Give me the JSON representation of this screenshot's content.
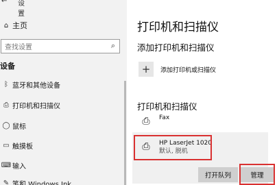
{
  "nav": {
    "back_icon": "back-arrow-icon",
    "title": "设置",
    "home_label": "主页",
    "search_placeholder": "查找设置",
    "section_label": "设备",
    "items": [
      {
        "icon": "bluetooth-icon",
        "label": "蓝牙和其他设备"
      },
      {
        "icon": "printer-icon",
        "label": "打印机和扫描仪"
      },
      {
        "icon": "mouse-icon",
        "label": "鼠标"
      },
      {
        "icon": "touchpad-icon",
        "label": "触摸板"
      },
      {
        "icon": "keyboard-icon",
        "label": "输入"
      },
      {
        "icon": "pen-icon",
        "label": "笔和 Windows Ink"
      }
    ]
  },
  "main": {
    "title": "打印机和扫描仪",
    "add_section": "添加打印机和扫描仪",
    "add_label": "添加打印机或扫描仪",
    "printers_section": "打印机和扫描仪",
    "printers": [
      {
        "name": "Fax",
        "status": ""
      },
      {
        "name": "HP LaserJet 1020",
        "status": "默认, 脱机"
      }
    ],
    "open_queue_label": "打开队列",
    "manage_label": "管理"
  },
  "colors": {
    "highlight": "#d93030",
    "nav_bg": "#f2f2f2",
    "button_bg": "#cfcfcf"
  }
}
